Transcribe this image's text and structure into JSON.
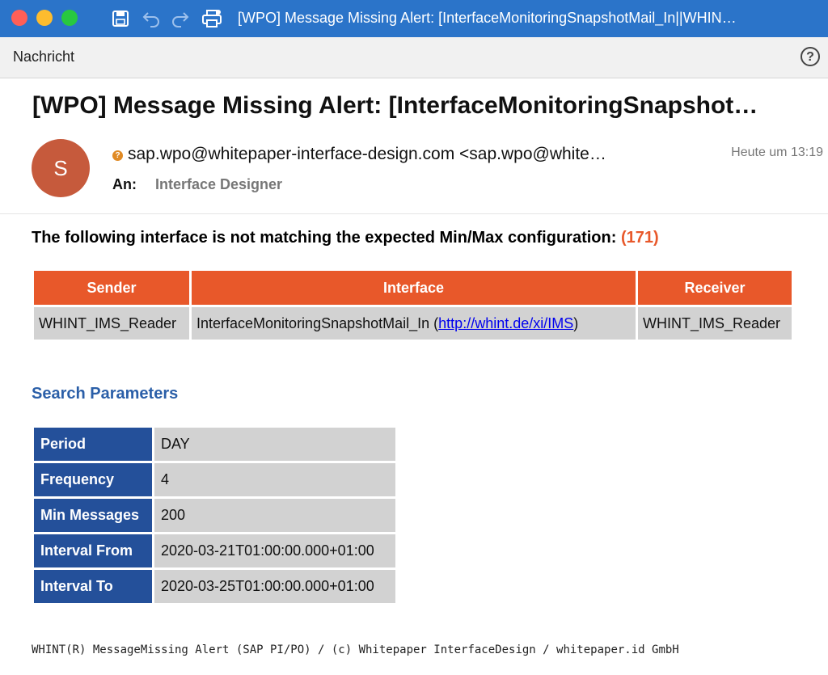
{
  "window": {
    "title": "[WPO] Message Missing Alert: [InterfaceMonitoringSnapshotMail_In||WHIN…",
    "colors": {
      "titlebar": "#2b74c9",
      "close": "#ff5f57",
      "minimize": "#febc2e",
      "maximize": "#28c840"
    }
  },
  "toolbar": {
    "tab_label": "Nachricht",
    "help_label": "?"
  },
  "message": {
    "subject": "[WPO] Message Missing Alert: [InterfaceMonitoringSnapshot…",
    "avatar_initial": "S",
    "from": "sap.wpo@whitepaper-interface-design.com <sap.wpo@white…",
    "date": "Heute um 13:19",
    "to_label": "An:",
    "to_value": "Interface Designer",
    "warning_mark": "?"
  },
  "body": {
    "intro_text": "The following interface is not matching the expected Min/Max configuration: ",
    "intro_count": "(171)",
    "interface_table": {
      "headers": [
        "Sender",
        "Interface",
        "Receiver"
      ],
      "row": {
        "sender": "WHINT_IMS_Reader",
        "interface_prefix": "InterfaceMonitoringSnapshotMail_In (",
        "interface_link": "http://whint.de/xi/IMS",
        "interface_suffix": ")",
        "receiver": "WHINT_IMS_Reader"
      }
    },
    "search_title": "Search Parameters",
    "params": [
      {
        "label": "Period",
        "value": "DAY"
      },
      {
        "label": "Frequency",
        "value": "4"
      },
      {
        "label": "Min Messages",
        "value": "200"
      },
      {
        "label": "Interval From",
        "value": "2020-03-21T01:00:00.000+01:00"
      },
      {
        "label": "Interval To",
        "value": "2020-03-25T01:00:00.000+01:00"
      }
    ],
    "footer": "WHINT(R) MessageMissing Alert (SAP PI/PO) / (c) Whitepaper InterfaceDesign / whitepaper.id GmbH",
    "colors": {
      "orange": "#e8582a",
      "blue_header": "#24509a",
      "section_title": "#2b5fa8",
      "cell_gray": "#d2d2d2"
    }
  }
}
